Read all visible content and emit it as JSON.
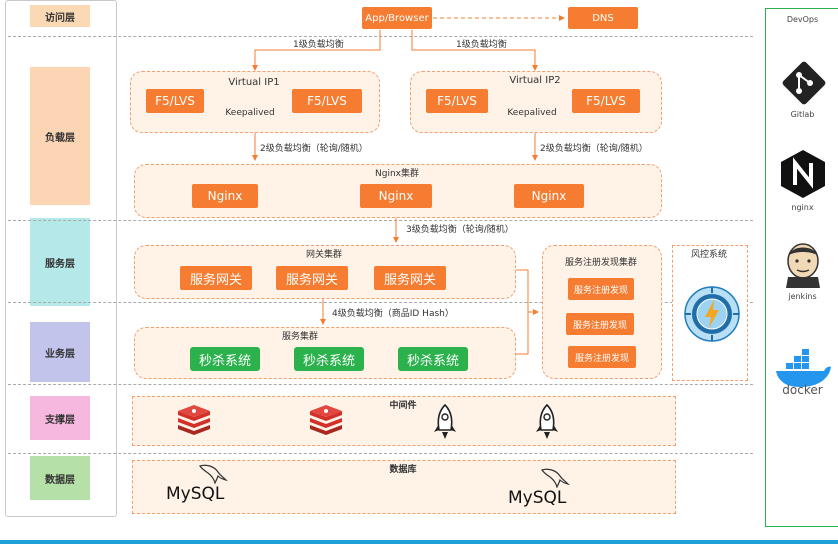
{
  "layers": [
    {
      "label": "访问层",
      "color": "#fcd9b5"
    },
    {
      "label": "负载层",
      "color": "#fbd5b4"
    },
    {
      "label": "服务层",
      "color": "#b5e8e8"
    },
    {
      "label": "业务层",
      "color": "#c2c4ec"
    },
    {
      "label": "支撑层",
      "color": "#f7b8e0"
    },
    {
      "label": "数据层",
      "color": "#b5e0a8"
    }
  ],
  "access": {
    "client": "App/Browser",
    "dns": "DNS"
  },
  "lb1": {
    "left": "1级负载均衡",
    "right": "1级负载均衡"
  },
  "vip1": {
    "title": "Virtual IP1",
    "f5a": "F5/LVS",
    "f5b": "F5/LVS",
    "keep": "Keepalived"
  },
  "vip2": {
    "title": "Virtual IP2",
    "f5a": "F5/LVS",
    "f5b": "F5/LVS",
    "keep": "Keepalived"
  },
  "lb2": {
    "left": "2级负载均衡（轮询/随机）",
    "right": "2级负载均衡（轮询/随机）"
  },
  "nginx": {
    "title": "Nginx集群",
    "items": [
      "Nginx",
      "Nginx",
      "Nginx"
    ]
  },
  "lb3": "3级负载均衡（轮询/随机）",
  "gateway": {
    "title": "网关集群",
    "items": [
      "服务网关",
      "服务网关",
      "服务网关"
    ]
  },
  "lb4": "4级负载均衡（商品ID Hash）",
  "service": {
    "title": "服务集群",
    "items": [
      "秒杀系统",
      "秒杀系统",
      "秒杀系统"
    ]
  },
  "registry": {
    "title": "服务注册发现集群",
    "items": [
      "服务注册发现",
      "服务注册发现",
      "服务注册发现"
    ]
  },
  "risk": {
    "title": "风控系统"
  },
  "middleware": {
    "title": "中间件"
  },
  "database": {
    "title": "数据库",
    "items": [
      "MySQL",
      "MySQL"
    ]
  },
  "devops": {
    "title": "DevOps",
    "items": [
      "Gitlab",
      "nginx",
      "jenkins",
      "docker"
    ]
  },
  "colors": {
    "orange": "#f57c30",
    "green": "#2bb24c",
    "redis": "#d3302a"
  }
}
